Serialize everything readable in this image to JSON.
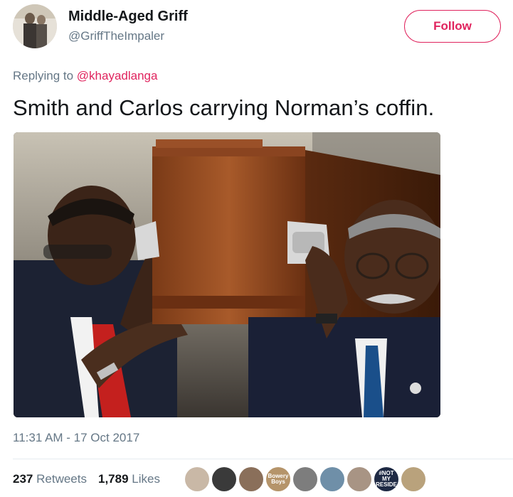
{
  "author": {
    "name": "Middle-Aged Griff",
    "handle": "@GriffTheImpaler"
  },
  "follow_label": "Follow",
  "reply": {
    "prefix": "Replying to ",
    "to": "@khayadlanga"
  },
  "tweet_text": "Smith and Carlos carrying Norman’s coffin.",
  "timestamp": "11:31 AM - 17 Oct 2017",
  "stats": {
    "retweets_count": "237",
    "retweets_label": "Retweets",
    "likes_count": "1,789",
    "likes_label": "Likes"
  },
  "likers": [
    {
      "name": "liker-1",
      "color": "#c9b8a6"
    },
    {
      "name": "liker-2",
      "color": "#3a3a3a"
    },
    {
      "name": "liker-3",
      "color": "#8a6f5a"
    },
    {
      "name": "liker-4",
      "color": "#b5946a",
      "text": "Bowery Boys"
    },
    {
      "name": "liker-5",
      "color": "#7d7d7d"
    },
    {
      "name": "liker-6",
      "color": "#6f8fa8"
    },
    {
      "name": "liker-7",
      "color": "#a89484"
    },
    {
      "name": "liker-8",
      "color": "#1f2a44",
      "text": "#NOT MY RESIDE"
    },
    {
      "name": "liker-9",
      "color": "#b9a27c"
    }
  ],
  "colors": {
    "accent": "#e0245e",
    "secondary_text": "#657786",
    "primary_text": "#14171a"
  }
}
